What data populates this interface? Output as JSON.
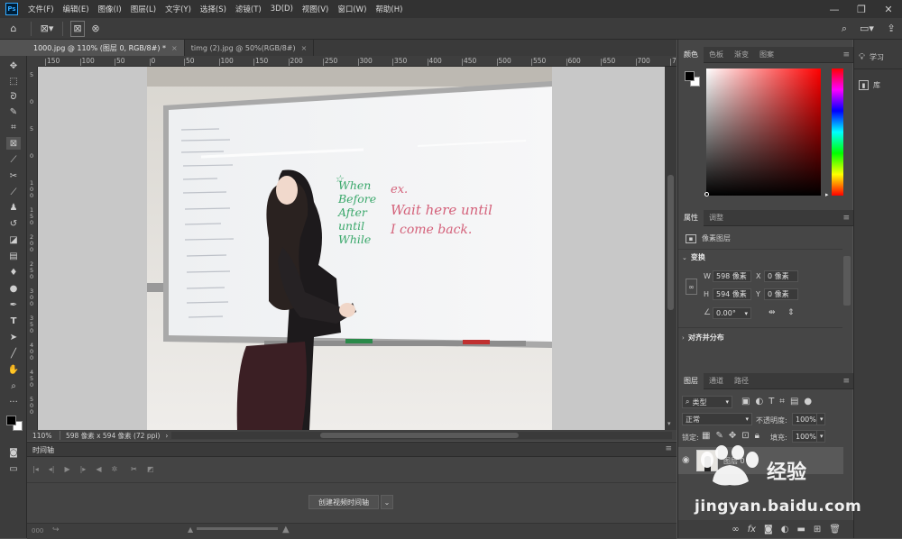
{
  "menu": {
    "logo": "Ps",
    "items": [
      "文件(F)",
      "编辑(E)",
      "图像(I)",
      "图层(L)",
      "文字(Y)",
      "选择(S)",
      "滤镜(T)",
      "3D(D)",
      "视图(V)",
      "窗口(W)",
      "帮助(H)"
    ],
    "minimize": "—",
    "maximize": "❐",
    "close": "✕"
  },
  "tabs": [
    {
      "label": "1000.jpg @ 110% (图层 0, RGB/8#) *",
      "close": "×"
    },
    {
      "label": "timg (2).jpg @ 50%(RGB/8#)",
      "close": "×"
    }
  ],
  "ruler": {
    "top": [
      "150",
      "100",
      "50",
      "0",
      "50",
      "100",
      "150",
      "200",
      "250",
      "300",
      "350",
      "400",
      "450",
      "500",
      "550",
      "600",
      "650",
      "700",
      "750"
    ],
    "left": [
      "5",
      "0",
      "5",
      "0",
      "1 0 0",
      "1 5 0",
      "2 0 0",
      "2 5 0",
      "3 0 0",
      "3 5 0",
      "4 0 0",
      "4 5 0",
      "5 0 0"
    ]
  },
  "whiteboard": {
    "green_lines": [
      "When",
      "Before",
      "After",
      "until",
      "While"
    ],
    "red_lines": [
      "ex.",
      "Wait here until",
      "I come back."
    ],
    "star": "☆"
  },
  "status": {
    "zoom": "110%",
    "doc_info": "598 像素 x 594 像素 (72 ppi)",
    "arrow": "›"
  },
  "timeline": {
    "title": "时间轴",
    "create_button": "创建视频时间轴",
    "footer_text": "000"
  },
  "color_panel": {
    "tabs": [
      "颜色",
      "色板",
      "渐变",
      "图案"
    ]
  },
  "properties_panel": {
    "tabs": [
      "属性",
      "调整"
    ],
    "layer_type": "像素图层",
    "transform_title": "变换",
    "w_label": "W",
    "w_value": "598 像素",
    "h_label": "H",
    "h_value": "594 像素",
    "x_label": "X",
    "x_value": "0 像素",
    "y_label": "Y",
    "y_value": "0 像素",
    "angle_value": "0.00°",
    "align_title": "对齐并分布"
  },
  "layers_panel": {
    "tabs": [
      "图层",
      "通道",
      "路径"
    ],
    "filter_label": "类型",
    "blend_mode": "正常",
    "opacity_label": "不透明度:",
    "opacity_value": "100%",
    "lock_label": "锁定:",
    "fill_label": "填充:",
    "fill_value": "100%",
    "layer_name": "图层 0"
  },
  "far_right": {
    "learn": "学习",
    "library": "库"
  },
  "watermark": {
    "brand": "经验",
    "url": "jingyan.baidu.com"
  },
  "colors": {
    "accent": "#31a8ff",
    "panel": "#464646",
    "dark": "#323232"
  }
}
